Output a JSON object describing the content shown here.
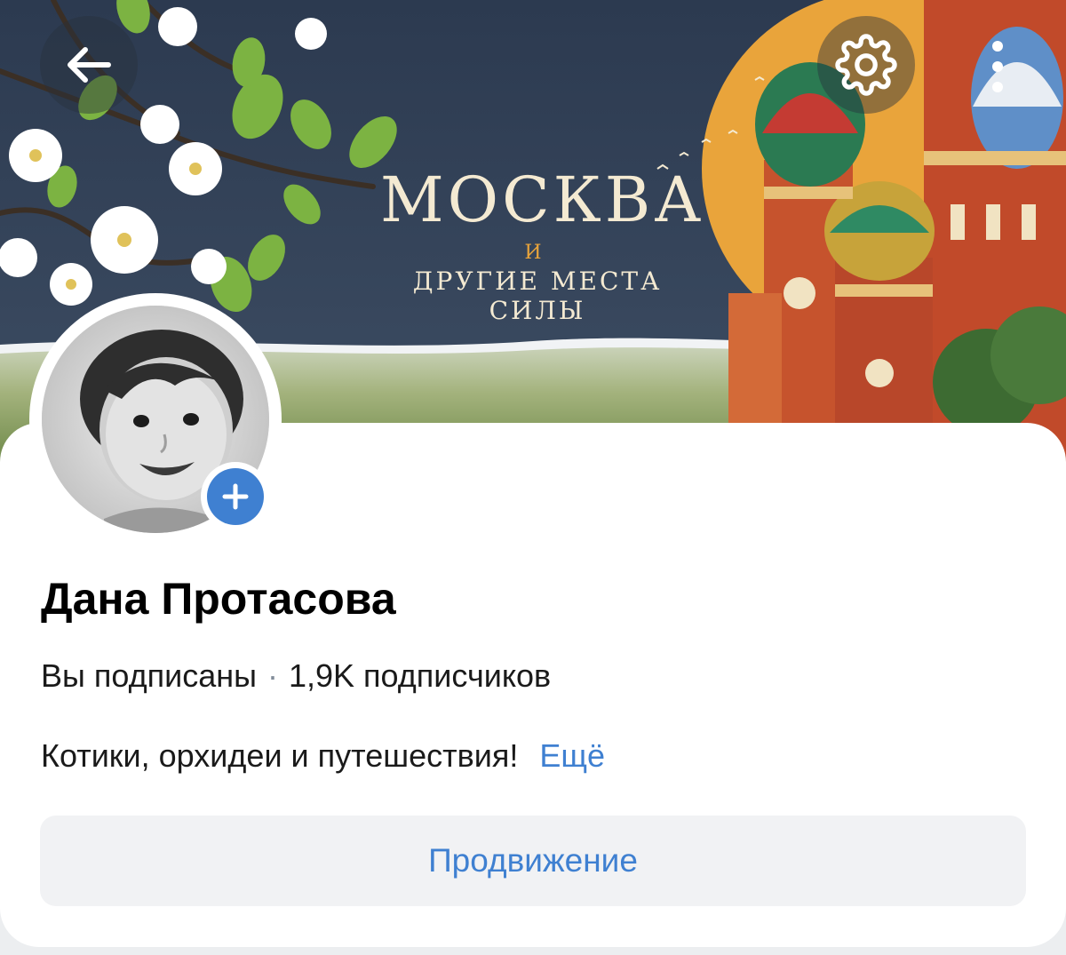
{
  "cover": {
    "title": "МОСКВА",
    "and": "И",
    "subtitle": "ДРУГИЕ МЕСТА СИЛЫ"
  },
  "header": {
    "back_icon": "arrow-left-icon",
    "settings_icon": "gear-icon",
    "more_icon": "vertical-dots-icon"
  },
  "profile": {
    "name": "Дана Протасова",
    "subscription_status": "Вы подписаны",
    "separator": "·",
    "followers": "1,9K подписчиков",
    "about": "Котики, орхидеи и путешествия!",
    "more_link": "Ещё",
    "promo_button": "Продвижение",
    "avatar_add_icon": "plus-icon"
  },
  "colors": {
    "accent": "#3f80d1",
    "cover_bg": "#34435a",
    "sun": "#e9a43b"
  }
}
